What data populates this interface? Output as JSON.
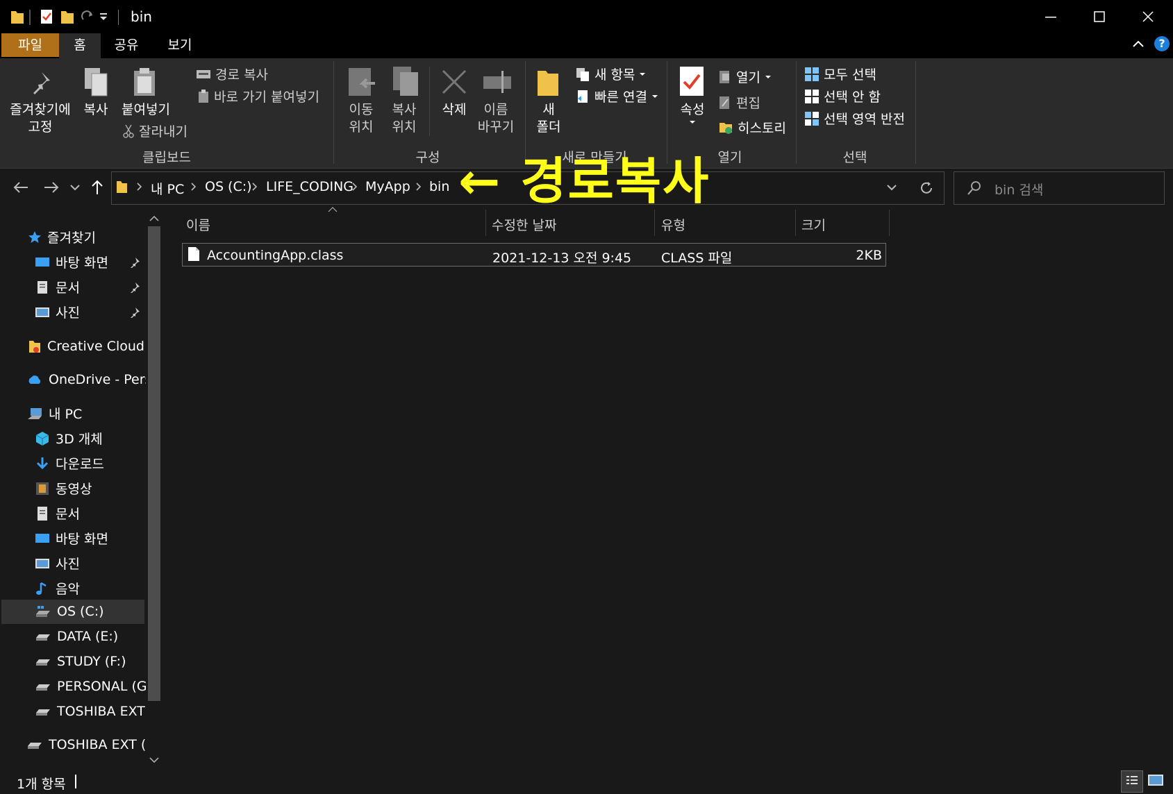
{
  "window": {
    "title": "bin",
    "minimize_icon": "minimize-icon",
    "maximize_icon": "maximize-icon",
    "close_icon": "close-icon"
  },
  "ribbon_tabs": [
    "파일",
    "홈",
    "공유",
    "보기"
  ],
  "ribbon": {
    "clipboard": {
      "label": "클립보드",
      "pin_line1": "즐겨찾기에",
      "pin_line2": "고정",
      "copy": "복사",
      "paste": "붙여넣기",
      "copy_path": "경로 복사",
      "paste_shortcut": "바로 가기 붙여넣기",
      "cut": "잘라내기"
    },
    "organize": {
      "label": "구성",
      "move_line1": "이동",
      "move_line2": "위치",
      "copyto_line1": "복사",
      "copyto_line2": "위치",
      "delete": "삭제",
      "rename_line1": "이름",
      "rename_line2": "바꾸기"
    },
    "new": {
      "label": "새로 만들기",
      "folder_line1": "새",
      "folder_line2": "폴더",
      "new_item": "새 항목",
      "easy_access": "빠른 연결"
    },
    "open": {
      "label": "열기",
      "properties": "속성",
      "open": "열기",
      "edit": "편집",
      "history": "히스토리"
    },
    "select": {
      "label": "선택",
      "select_all": "모두 선택",
      "select_none": "선택 안 함",
      "invert": "선택 영역 반전"
    }
  },
  "address": {
    "crumbs": [
      "내 PC",
      "OS (C:)",
      "LIFE_CODING",
      "MyApp",
      "bin"
    ],
    "search_placeholder": "bin 검색"
  },
  "annotation": "← 경로복사",
  "sidebar": {
    "quick_access": "즐겨찾기",
    "quick_items": [
      "바탕 화면",
      "문서",
      "사진"
    ],
    "creative_cloud": "Creative Cloud Files",
    "onedrive": "OneDrive - Personal",
    "this_pc": "내 PC",
    "pc_items": [
      "3D 개체",
      "다운로드",
      "동영상",
      "문서",
      "바탕 화면",
      "사진",
      "음악",
      "OS (C:)",
      "DATA (E:)",
      "STUDY (F:)",
      "PERSONAL (G:)",
      "TOSHIBA EXT (I:)"
    ],
    "external": "TOSHIBA EXT (I:)"
  },
  "columns": [
    "이름",
    "수정한 날짜",
    "유형",
    "크기"
  ],
  "files": [
    {
      "name": "AccountingApp.class",
      "modified": "2021-12-13 오전 9:45",
      "type": "CLASS 파일",
      "size": "2KB"
    }
  ],
  "status": {
    "count": "1개 항목"
  },
  "colors": {
    "accent_file_tab": "#b0701a",
    "annotation": "#ffff1a",
    "folder": "#f0c24a",
    "link_blue": "#3aa0f3"
  }
}
